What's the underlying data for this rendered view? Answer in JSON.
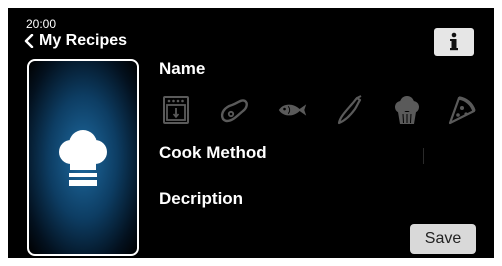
{
  "status": {
    "time": "20:00"
  },
  "header": {
    "back_label": "My Recipes",
    "info_icon": "info-icon"
  },
  "recipe": {
    "image_icon": "chef-hat-icon"
  },
  "fields": {
    "name_label": "Name",
    "cook_method_label": "Cook Method",
    "description_label": "Decription"
  },
  "categories": [
    "oven-icon",
    "meat-icon",
    "fish-icon",
    "vegetable-icon",
    "muffin-icon",
    "pizza-icon"
  ],
  "actions": {
    "save_label": "Save"
  },
  "colors": {
    "background": "#000000",
    "text": "#ffffff",
    "category_icon": "#5a5a5a",
    "button": "#d9d9d9",
    "card_glow": "#1e6aa0"
  }
}
